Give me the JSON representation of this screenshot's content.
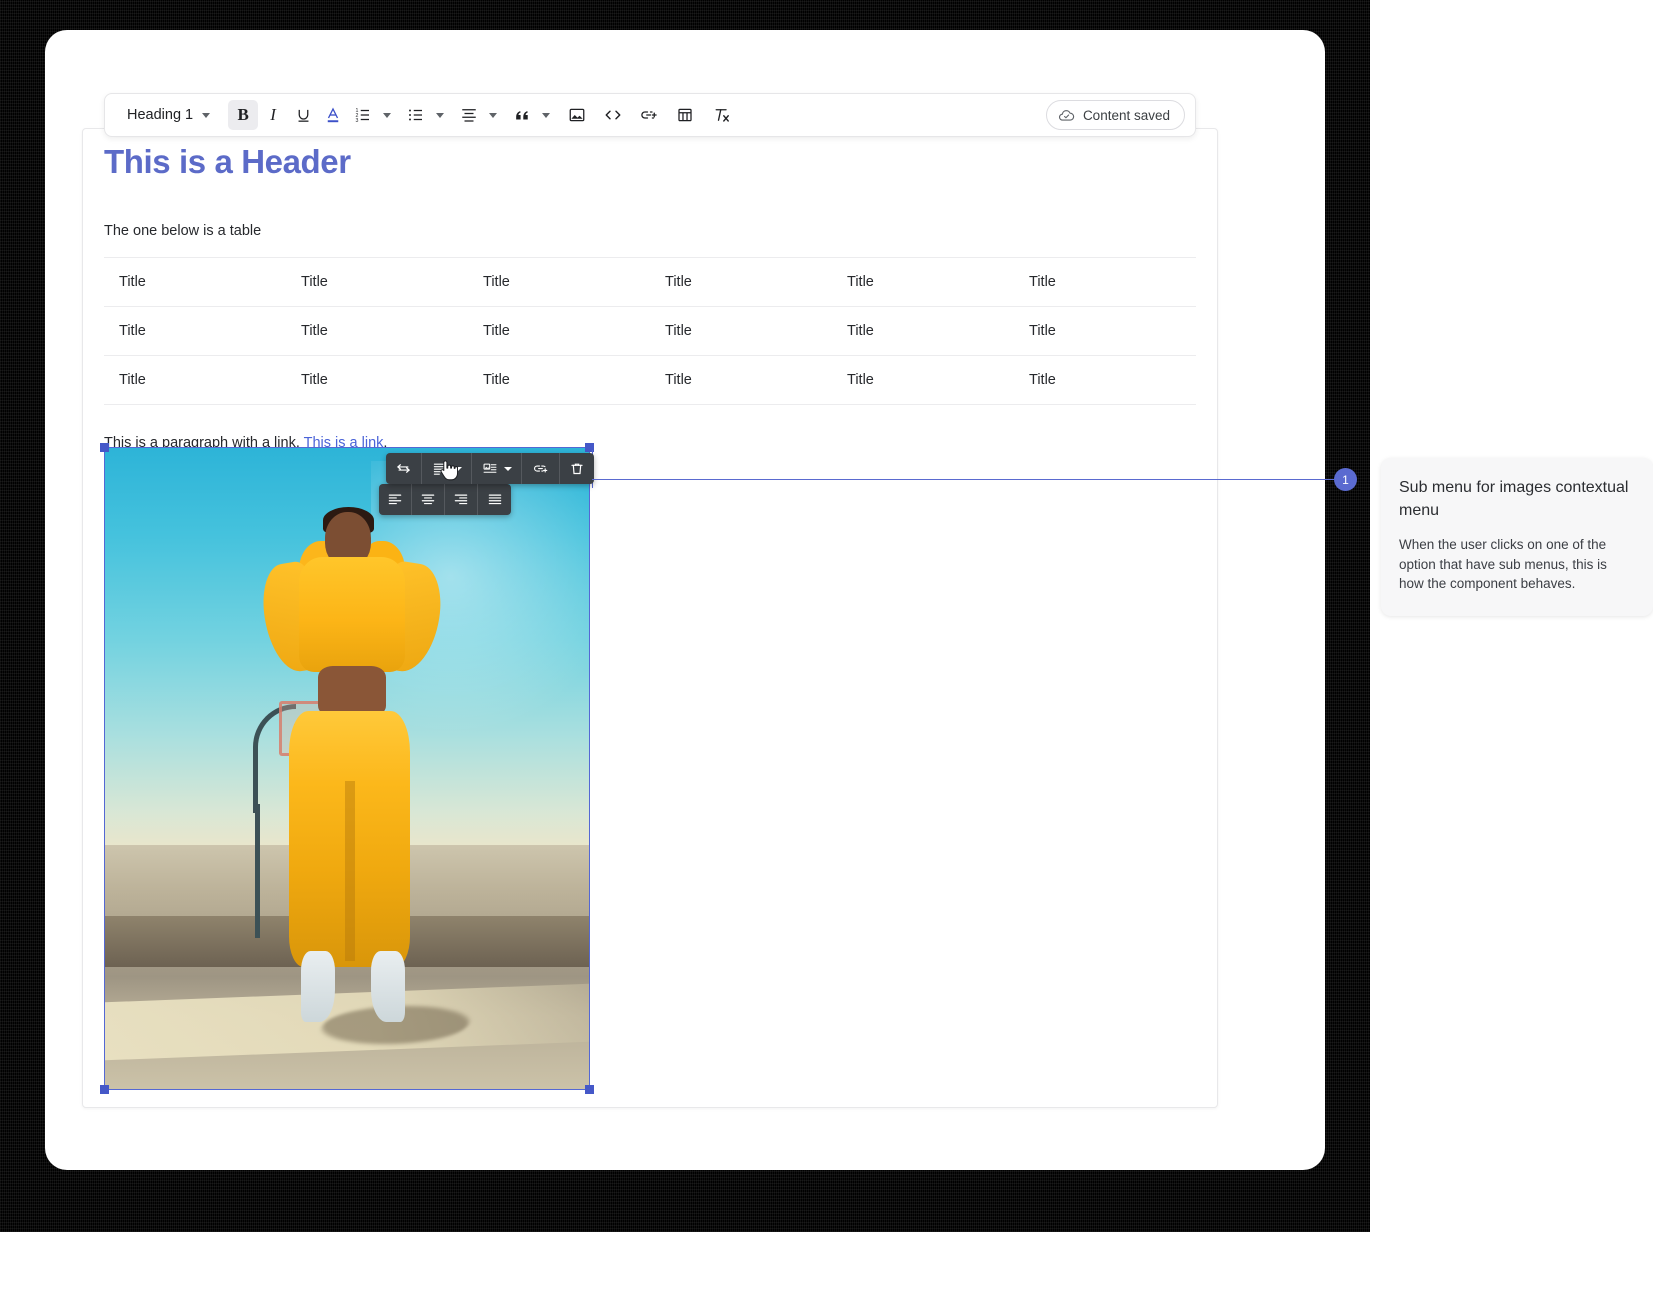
{
  "window": {
    "title": "Rich text editor"
  },
  "toolbar": {
    "heading_label": "Heading 1",
    "saved_label": "Content saved",
    "buttons": [
      {
        "name": "bold-button",
        "label": "B",
        "active": true
      },
      {
        "name": "italic-button",
        "label": "I",
        "active": false
      },
      {
        "name": "underline-button",
        "label": "U",
        "active": false
      },
      {
        "name": "font-color-button",
        "label": "A",
        "active": false
      },
      {
        "name": "ordered-list-button",
        "label": "Ordered list",
        "active": false
      },
      {
        "name": "bulleted-list-button",
        "label": "Bulleted list",
        "active": false
      },
      {
        "name": "text-align-button",
        "label": "Text align",
        "active": false
      },
      {
        "name": "blockquote-button",
        "label": "Blockquote",
        "active": false
      },
      {
        "name": "insert-image-button",
        "label": "Insert image",
        "active": false
      },
      {
        "name": "code-block-button",
        "label": "Code block",
        "active": false
      },
      {
        "name": "insert-link-button",
        "label": "Insert link",
        "active": false
      },
      {
        "name": "insert-table-button",
        "label": "Insert table",
        "active": false
      },
      {
        "name": "clear-formatting-button",
        "label": "Clear formatting",
        "active": false
      }
    ]
  },
  "document": {
    "heading": "This is a Header",
    "intro_paragraph": "The one below is a table",
    "heading_color": "#5c6bc8",
    "table": {
      "rows": [
        [
          "Title",
          "Title",
          "Title",
          "Title",
          "Title",
          "Title"
        ],
        [
          "Title",
          "Title",
          "Title",
          "Title",
          "Title",
          "Title"
        ],
        [
          "Title",
          "Title",
          "Title",
          "Title",
          "Title",
          "Title"
        ]
      ]
    },
    "link_paragraph": {
      "before": "This is a paragraph with a link.",
      "link_text": "This is a link",
      "after": ".",
      "link_color": "#4a63d8"
    }
  },
  "image_contextual_menu": {
    "items": [
      {
        "name": "resize-image-button",
        "icon": "resize-horizontal-icon",
        "has_caret": false
      },
      {
        "name": "text-wrap-button",
        "icon": "text-wrap-icon",
        "has_caret": true
      },
      {
        "name": "image-position-button",
        "icon": "image-position-icon",
        "has_caret": true
      },
      {
        "name": "image-link-button",
        "icon": "link-add-icon",
        "has_caret": false
      },
      {
        "name": "delete-image-button",
        "icon": "trash-icon",
        "has_caret": false
      }
    ],
    "submenu": {
      "open": true,
      "items": [
        {
          "name": "align-left-button",
          "icon": "align-left-icon"
        },
        {
          "name": "align-center-button",
          "icon": "align-center-icon"
        },
        {
          "name": "align-right-button",
          "icon": "align-right-icon"
        },
        {
          "name": "align-justify-button",
          "icon": "align-justify-icon"
        }
      ]
    },
    "selection_color": "#5468d4"
  },
  "annotation": {
    "number": "1",
    "title": "Sub menu for images contextual menu",
    "description": "When the user clicks on one of the option that have sub menus, this is how the component behaves.",
    "accent_color": "#5a6ad0"
  }
}
